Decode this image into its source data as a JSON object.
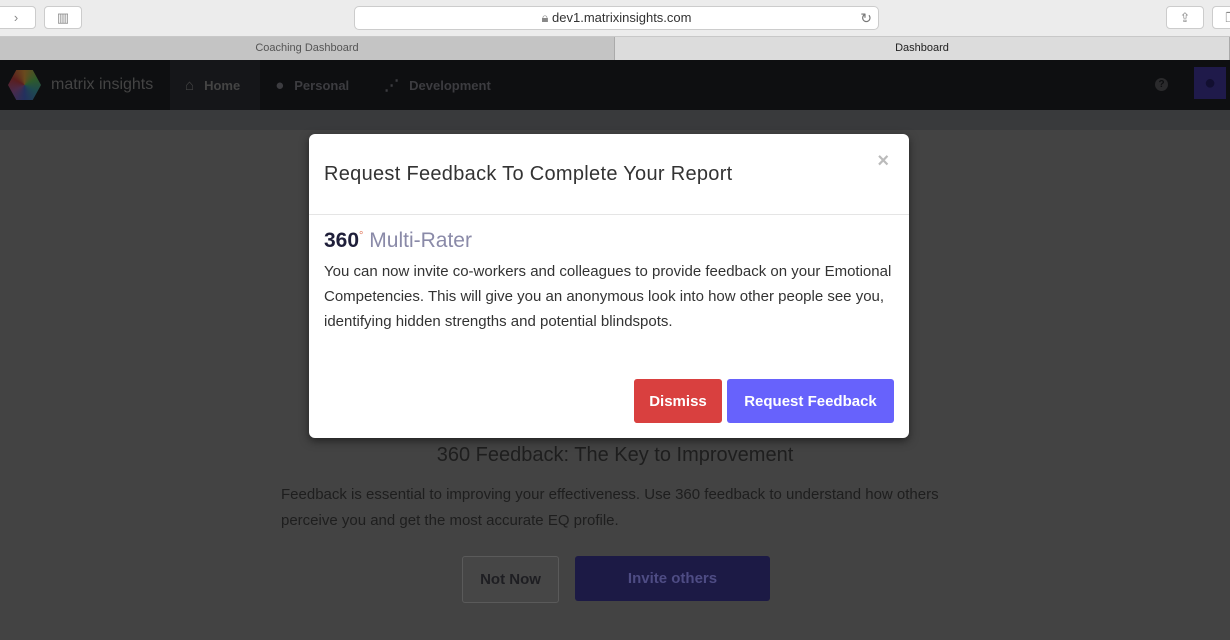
{
  "browser": {
    "url": "dev1.matrixinsights.com",
    "tabs": [
      {
        "label": "Coaching Dashboard"
      },
      {
        "label": "Dashboard"
      }
    ]
  },
  "nav": {
    "brand": "matrix insights",
    "items": [
      {
        "label": "Home",
        "icon": "home-icon"
      },
      {
        "label": "Personal",
        "icon": "user-icon"
      },
      {
        "label": "Development",
        "icon": "trend-icon"
      }
    ],
    "help": "?"
  },
  "page": {
    "title": "360 Feedback: The Key to Improvement",
    "text": "Feedback is essential to improving your effectiveness. Use 360 feedback to understand how others perceive you and get the most accurate EQ profile.",
    "not_now": "Not Now",
    "invite": "Invite others"
  },
  "modal": {
    "title": "Request Feedback To Complete Your Report",
    "close": "×",
    "subtitle_num": "360",
    "subtitle_deg": "°",
    "subtitle_text": "Multi-Rater",
    "body": "You can now invite co-workers and colleagues to provide feedback on your Emotional Competencies. This will give you an anonymous look into how other people see you, identifying hidden strengths and potential blindspots.",
    "dismiss": "Dismiss",
    "request": "Request Feedback"
  },
  "colors": {
    "accent": "#6762fc",
    "danger": "#d9403f"
  }
}
